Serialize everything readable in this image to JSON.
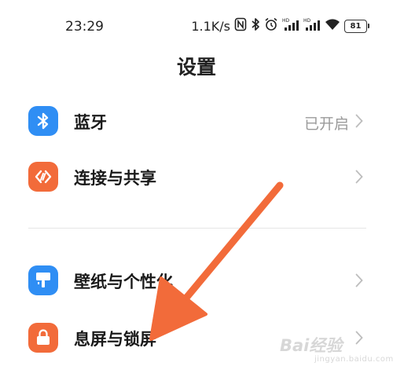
{
  "status_bar": {
    "time": "23:29",
    "net_speed": "1.1K/s",
    "battery": "81",
    "icons": [
      "nfc-icon",
      "bluetooth-icon",
      "alarm-icon",
      "signal-icon",
      "signal-icon",
      "wifi-icon",
      "battery-icon"
    ]
  },
  "page": {
    "title": "设置"
  },
  "settings": {
    "bluetooth": {
      "label": "蓝牙",
      "value": "已开启",
      "icon": "bluetooth-icon",
      "color": "#2f8ef4"
    },
    "connection": {
      "label": "连接与共享",
      "icon": "share-icon",
      "color": "#f26b3a"
    },
    "wallpaper": {
      "label": "壁纸与个性化",
      "icon": "wallpaper-icon",
      "color": "#2f8ef4"
    },
    "lockscreen": {
      "label": "息屏与锁屏",
      "icon": "lock-icon",
      "color": "#f26b3a"
    }
  },
  "annotation": {
    "arrow_color": "#f26b3a"
  },
  "watermark": {
    "text": "Bai经验",
    "sub": "jingyan.baidu.com"
  }
}
